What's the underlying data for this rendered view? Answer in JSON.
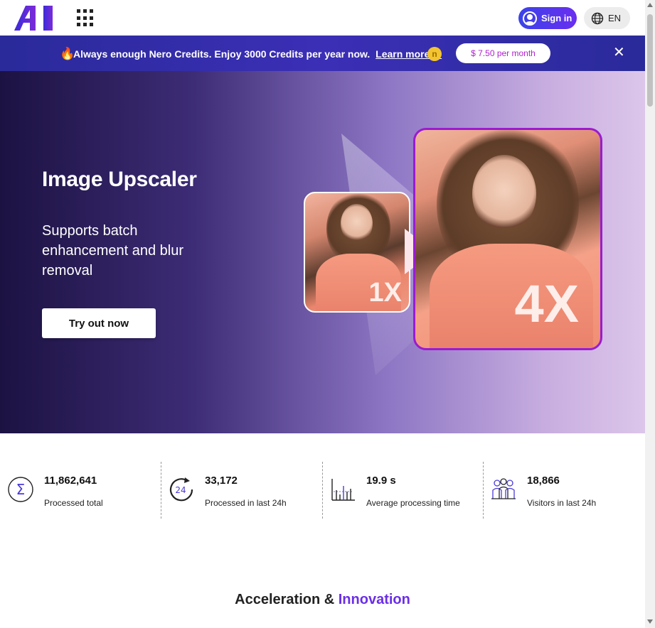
{
  "header": {
    "logo_text": "AI",
    "apps_icon": "grid-icon",
    "signin_label": "Sign in",
    "language_label": "EN"
  },
  "banner": {
    "message": "Always enough Nero Credits. Enjoy 3000 Credits per year now.",
    "learn_more": "Learn more ->",
    "coin_symbol": "n",
    "price": "$ 7.50 per month",
    "close_symbol": "✕"
  },
  "hero": {
    "title": "Image Upscaler",
    "subtitle": "Supports batch enhancement and blur removal",
    "cta": "Try out now",
    "small_label": "1X",
    "big_label": "4X"
  },
  "stats": [
    {
      "value": "11,862,641",
      "label": "Processed total",
      "icon": "sigma-icon"
    },
    {
      "value": "33,172",
      "label": "Processed in last 24h",
      "icon": "clock-24h-icon"
    },
    {
      "value": "19.9 s",
      "label": "Average processing time",
      "icon": "bar-chart-icon"
    },
    {
      "value": "18,866",
      "label": "Visitors in last 24h",
      "icon": "visitors-icon"
    }
  ],
  "section": {
    "title_a": "Acceleration & ",
    "title_b": "Innovation"
  },
  "colors": {
    "accent": "#6b2ee8",
    "banner": "#2a2a9a",
    "price_text": "#b020d0",
    "frame": "#9b1bd0"
  }
}
